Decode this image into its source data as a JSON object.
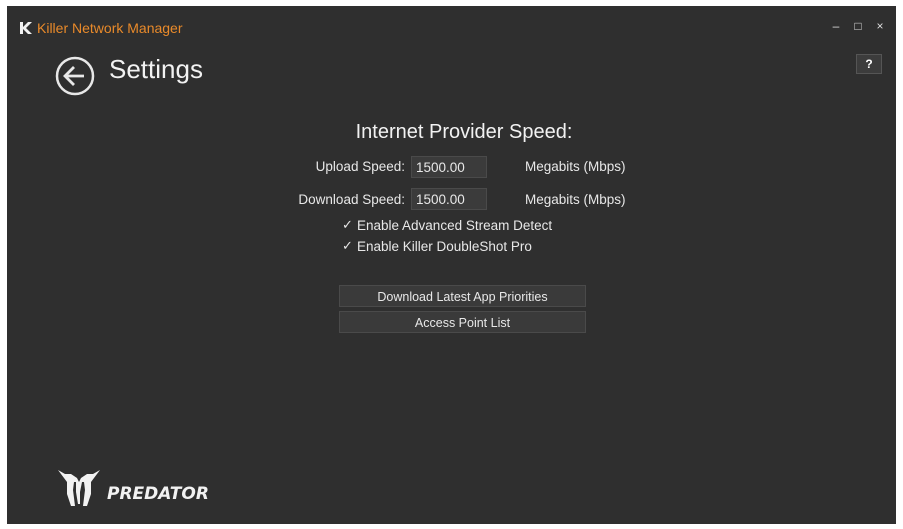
{
  "app": {
    "title": "Killer Network Manager"
  },
  "window_controls": {
    "minimize": "–",
    "maximize": "□",
    "close": "×"
  },
  "header": {
    "title": "Settings",
    "help_label": "?"
  },
  "provider": {
    "title": "Internet Provider Speed:",
    "upload_label": "Upload Speed:",
    "upload_value": "1500.00",
    "download_label": "Download Speed:",
    "download_value": "1500.00",
    "unit": "Megabits (Mbps)"
  },
  "options": [
    {
      "label": "Enable Advanced Stream Detect",
      "checked": true
    },
    {
      "label": "Enable Killer DoubleShot Pro",
      "checked": true
    }
  ],
  "actions": {
    "download_priorities": "Download Latest App Priorities",
    "access_point_list": "Access Point List"
  },
  "brand": {
    "name": "PREDATOR"
  },
  "colors": {
    "accent": "#e98a2a",
    "background": "#2f2f2f"
  }
}
